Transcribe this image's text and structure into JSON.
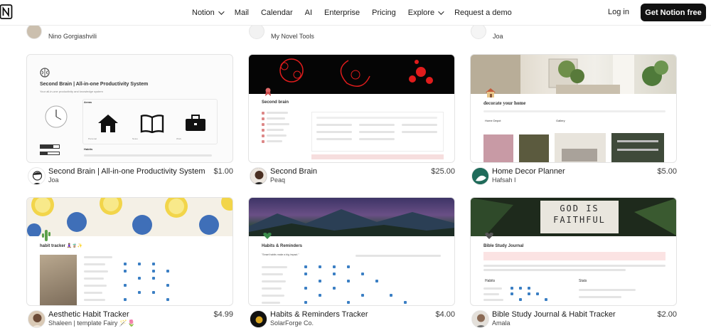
{
  "nav": {
    "logo_icon": "notion-logo-icon",
    "links": [
      {
        "label": "Notion",
        "has_chevron": true
      },
      {
        "label": "Mail",
        "has_chevron": false
      },
      {
        "label": "Calendar",
        "has_chevron": false
      },
      {
        "label": "AI",
        "has_chevron": false
      },
      {
        "label": "Enterprise",
        "has_chevron": false
      },
      {
        "label": "Pricing",
        "has_chevron": false
      },
      {
        "label": "Explore",
        "has_chevron": true
      },
      {
        "label": "Request a demo",
        "has_chevron": false
      }
    ],
    "login": "Log in",
    "cta": "Get Notion free"
  },
  "partial_row": [
    {
      "author": "Nino Gorgiashvili"
    },
    {
      "author": "My Novel Tools"
    },
    {
      "author": "Joa"
    }
  ],
  "cards": [
    {
      "title": "Second Brain | All-in-one Productivity System",
      "author": "Joa",
      "price": "$1.00",
      "thumb": {
        "heading": "Second Brain | All-in-one Productivity  System",
        "subheading": "Your all-in-one productivity and knowledge system",
        "section_areas": "Areas",
        "section_habits": "Habits",
        "area_labels": [
          "Personal",
          "Notes",
          "Work"
        ]
      }
    },
    {
      "title": "Second Brain",
      "author": "Peaq",
      "price": "$25.00",
      "thumb": {
        "heading": "Second brain"
      }
    },
    {
      "title": "Home Decor Planner",
      "author": "Hafsah I",
      "price": "$5.00",
      "thumb": {
        "heading": "decorate your home",
        "col_a": "Home Depot",
        "col_b": "Gallery"
      }
    },
    {
      "title": "Aesthetic Habit Tracker",
      "author": "Shaleen | template Fairy 🪄🌷",
      "price": "$4.99",
      "thumb": {
        "heading": "habit tracker 🧘🏽‍♀️🧋✨"
      }
    },
    {
      "title": "Habits & Reminders Tracker",
      "author": "SolarForge Co.",
      "price": "$4.00",
      "thumb": {
        "heading": "Habits & Reminders",
        "quote": "\"Smart habits make a big impact.\""
      }
    },
    {
      "title": "Bible Study Journal & Habit Tracker",
      "author": "Amala",
      "price": "$2.00",
      "thumb": {
        "heading": "Bible Study Journal",
        "banner_line1": "GOD IS",
        "banner_line2": "FAITHFUL",
        "col_habits": "Habits",
        "col_stats": "Stats"
      }
    }
  ],
  "colors": {
    "cta_bg": "#111111",
    "card_border": "#e3e3e3",
    "habit_blue": "#3b7fc4",
    "neon_red": "#e01c1c"
  }
}
